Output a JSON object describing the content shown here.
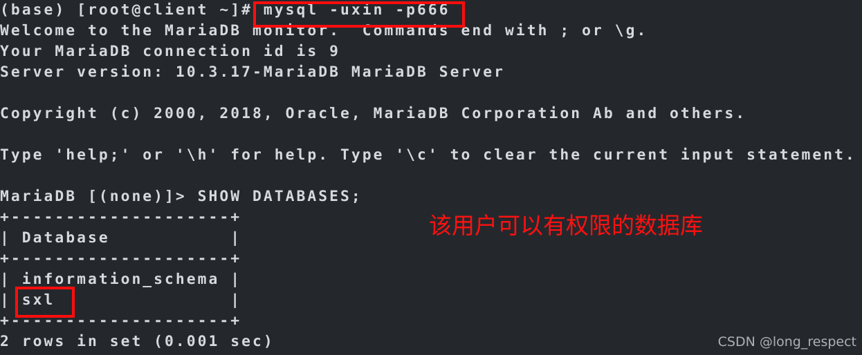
{
  "terminal": {
    "background_color": "#24282c",
    "foreground_color": "#d6dade",
    "lines": [
      "(base) [root@client ~]# mysql -uxin -p666",
      "Welcome to the MariaDB monitor.  Commands end with ; or \\g.",
      "Your MariaDB connection id is 9",
      "Server version: 10.3.17-MariaDB MariaDB Server",
      "",
      "Copyright (c) 2000, 2018, Oracle, MariaDB Corporation Ab and others.",
      "",
      "Type 'help;' or '\\h' for help. Type '\\c' to clear the current input statement.",
      "",
      "MariaDB [(none)]> SHOW DATABASES;",
      "+--------------------+",
      "| Database           |",
      "+--------------------+",
      "| information_schema |",
      "| sxl                |",
      "+--------------------+",
      "2 rows in set (0.001 sec)"
    ],
    "prompt": "(base) [root@client ~]#",
    "command": "mysql -uxin -p666",
    "sql_prompt": "MariaDB [(none)]>",
    "sql_command": "SHOW DATABASES;",
    "table": {
      "header": "Database",
      "rows": [
        "information_schema",
        "sxl"
      ],
      "row_count_status": "2 rows in set (0.001 sec)"
    }
  },
  "annotations": {
    "color": "#ff0d0d",
    "command_highlight_label": "mysql -uxin -p666",
    "database_highlight_label": "sxl",
    "note_text": "该用户可以有权限的数据库"
  },
  "watermark": {
    "text": "CSDN @long_respect",
    "color": "#b9bdc1"
  }
}
